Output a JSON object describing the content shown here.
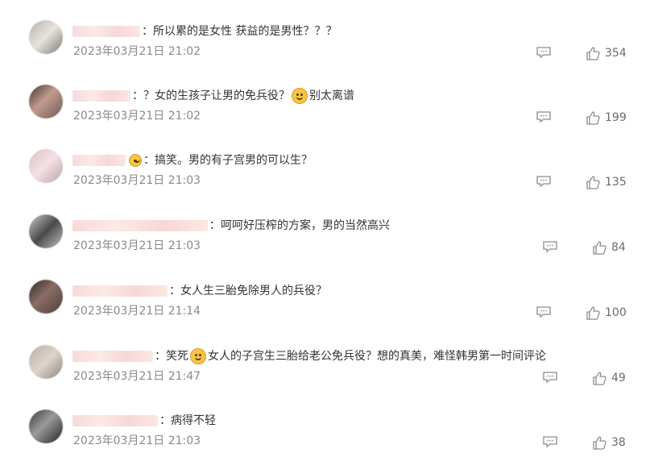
{
  "comments": [
    {
      "text": "所以累的是女性 获益的是男性？？？",
      "date": "2023年03月21日 21:02",
      "likes": "354",
      "emoji_after_prefix": false,
      "emoji_mid": false
    },
    {
      "text_a": "？女的生孩子让男的免兵役？",
      "text_b": "别太离谱",
      "date": "2023年03月21日 21:02",
      "likes": "199",
      "emoji_name": "awkward-sweat-emoji"
    },
    {
      "text": "搞笑。男的有子宫男的可以生？",
      "date": "2023年03月21日 21:03",
      "likes": "135",
      "emoji_name": "facepalm-emoji"
    },
    {
      "text": "呵呵好压榨的方案，男的当然高兴",
      "date": "2023年03月21日 21:03",
      "likes": "84"
    },
    {
      "text": "女人生三胎免除男人的兵役？",
      "date": "2023年03月21日 21:14",
      "likes": "100"
    },
    {
      "text_a": "笑死",
      "text_b": "女人的子宫生三胎给老公免兵役？想的真美，难怪韩男第一时间评论",
      "date": "2023年03月21日 21:47",
      "likes": "49",
      "emoji_name": "laughing-emoji"
    },
    {
      "text": "病得不轻",
      "date": "2023年03月21日 21:03",
      "likes": "38"
    }
  ],
  "colors": {
    "username_blur": "#f7d3d3",
    "text": "#333333",
    "meta": "#8a8a8a",
    "icon": "#8c8c8c"
  }
}
